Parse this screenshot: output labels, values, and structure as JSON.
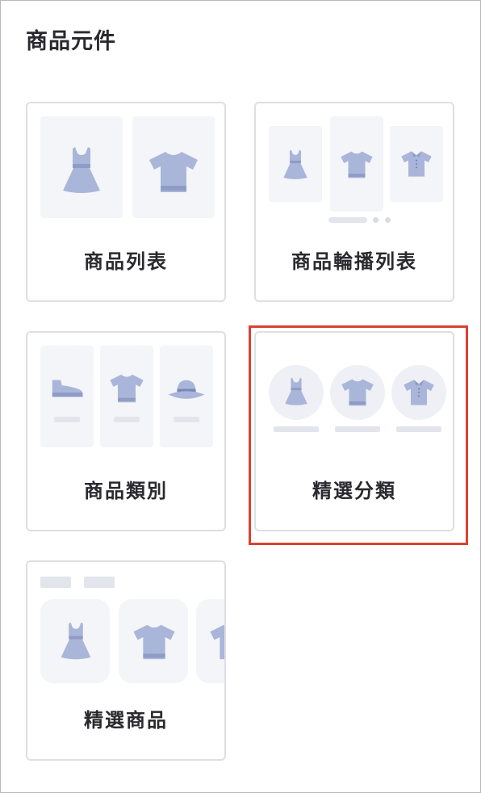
{
  "panel": {
    "title": "商品元件"
  },
  "components": [
    {
      "label": "商品列表",
      "icons": [
        "dress-icon",
        "tshirt-icon"
      ]
    },
    {
      "label": "商品輪播列表",
      "icons": [
        "dress-icon",
        "tshirt-icon",
        "polo-shirt-icon"
      ]
    },
    {
      "label": "商品類別",
      "icons": [
        "shoe-icon",
        "tshirt-icon",
        "hat-icon"
      ]
    },
    {
      "label": "精選分類",
      "icons": [
        "dress-icon",
        "tshirt-icon",
        "polo-shirt-icon"
      ],
      "selected": true
    },
    {
      "label": "精選商品",
      "icons": [
        "dress-icon",
        "tshirt-icon",
        "polo-shirt-icon"
      ]
    }
  ],
  "colors": {
    "selection_border": "#d9432f",
    "icon_fill": "#a9b6d9",
    "icon_shade": "#8e9cc6",
    "card_border": "#dedee4",
    "placeholder_bg": "#f4f5f9"
  }
}
